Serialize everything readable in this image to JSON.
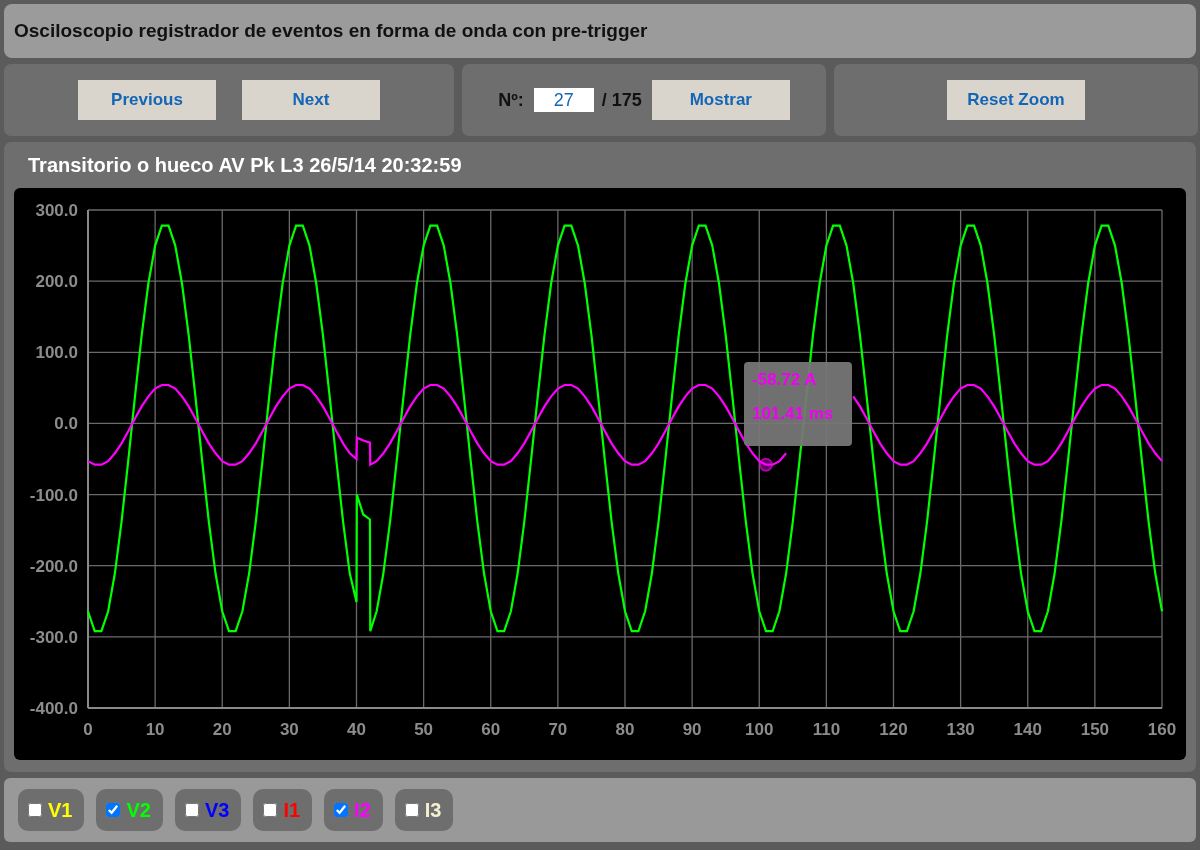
{
  "title": "Osciloscopio registrador de eventos en forma de onda con pre-trigger",
  "toolbar": {
    "previous": "Previous",
    "next": "Next",
    "number_label": "Nº:",
    "number_value": "27",
    "total": "/ 175",
    "show": "Mostrar",
    "reset_zoom": "Reset Zoom"
  },
  "chart": {
    "heading": "Transitorio o hueco AV Pk L3 26/5/14 20:32:59",
    "tooltip": {
      "lines": [
        "-58.72 A",
        "101.41 ms"
      ]
    },
    "chart_data": {
      "type": "line",
      "grid": true,
      "xlim": [
        0,
        160
      ],
      "ylim": [
        -400,
        300
      ],
      "xticks": [
        0,
        10,
        20,
        30,
        40,
        50,
        60,
        70,
        80,
        90,
        100,
        110,
        120,
        130,
        140,
        150,
        160
      ],
      "yticks": [
        {
          "value": 300,
          "label": "300.0"
        },
        {
          "value": 200,
          "label": "200.0"
        },
        {
          "value": 100,
          "label": "100.0"
        },
        {
          "value": 0,
          "label": "0.0"
        },
        {
          "value": -100,
          "label": "-100.0"
        },
        {
          "value": -200,
          "label": "-200.0"
        },
        {
          "value": -300,
          "label": "-300.0"
        },
        {
          "value": -400,
          "label": "-400.0"
        }
      ],
      "x": [
        0,
        1,
        2,
        3,
        4,
        5,
        6,
        7,
        8,
        9,
        10,
        11,
        12,
        13,
        14,
        15,
        16,
        17,
        18,
        19,
        20,
        21,
        22,
        23,
        24,
        25,
        26,
        27,
        28,
        29,
        30,
        31,
        32,
        33,
        34,
        35,
        36,
        37,
        38,
        39,
        40,
        40.05,
        41,
        42,
        42.05,
        43,
        44,
        45,
        46,
        47,
        48,
        49,
        50,
        51,
        52,
        53,
        54,
        55,
        56,
        57,
        58,
        59,
        60,
        61,
        62,
        63,
        64,
        65,
        66,
        67,
        68,
        69,
        70,
        71,
        72,
        73,
        74,
        75,
        76,
        77,
        78,
        79,
        80,
        81,
        82,
        83,
        84,
        85,
        86,
        87,
        88,
        89,
        90,
        91,
        92,
        93,
        94,
        95,
        96,
        97,
        98,
        99,
        100,
        101,
        102,
        103,
        104,
        105,
        106,
        108,
        109,
        110,
        111,
        112,
        113,
        114,
        115,
        116,
        117,
        118,
        119,
        120,
        121,
        122,
        123,
        124,
        125,
        126,
        127,
        128,
        129,
        130,
        131,
        132,
        133,
        134,
        135,
        136,
        137,
        138,
        139,
        140,
        141,
        142,
        143,
        144,
        145,
        146,
        147,
        148,
        149,
        150,
        151,
        152,
        153,
        154,
        155,
        156,
        157,
        158,
        159,
        160
      ],
      "series": [
        {
          "color": "#00ff00",
          "values": [
            -264,
            -292,
            -292,
            -264,
            -211,
            -138,
            -52,
            38,
            124,
            197,
            250,
            278,
            278,
            250,
            197,
            124,
            38,
            -52,
            -138,
            -211,
            -264,
            -292,
            -292,
            -264,
            -211,
            -138,
            -52,
            38,
            124,
            197,
            250,
            278,
            278,
            250,
            197,
            124,
            38,
            -52,
            -138,
            -211,
            -251,
            -100,
            -128,
            -135,
            -292,
            -264,
            -211,
            -138,
            -52,
            38,
            124,
            197,
            250,
            278,
            278,
            250,
            197,
            124,
            38,
            -52,
            -138,
            -211,
            -264,
            -292,
            -292,
            -264,
            -211,
            -138,
            -52,
            38,
            124,
            197,
            250,
            278,
            278,
            250,
            197,
            124,
            38,
            -52,
            -138,
            -211,
            -264,
            -292,
            -292,
            -264,
            -211,
            -138,
            -52,
            38,
            124,
            197,
            250,
            278,
            278,
            250,
            197,
            124,
            38,
            -52,
            -138,
            -211,
            -264,
            -292,
            -292,
            -264,
            -211,
            -138,
            -52,
            124,
            197,
            250,
            278,
            278,
            250,
            197,
            124,
            38,
            -52,
            -138,
            -211,
            -264,
            -292,
            -292,
            -264,
            -211,
            -138,
            -52,
            38,
            124,
            197,
            250,
            278,
            278,
            250,
            197,
            124,
            38,
            -52,
            -138,
            -211,
            -264,
            -292,
            -292,
            -264,
            -211,
            -138,
            -52,
            38,
            124,
            197,
            250,
            278,
            278,
            250,
            197,
            124,
            38,
            -52,
            -138,
            -211,
            -264
          ]
        },
        {
          "color": "#ff00ff",
          "values": [
            -53,
            -58,
            -58,
            -53,
            -42,
            -28,
            -11,
            7,
            24,
            38,
            49,
            54,
            54,
            49,
            38,
            24,
            7,
            -11,
            -28,
            -42,
            -53,
            -58,
            -58,
            -53,
            -42,
            -28,
            -11,
            7,
            24,
            38,
            49,
            54,
            54,
            49,
            38,
            24,
            7,
            -11,
            -28,
            -42,
            -50,
            -20,
            -24,
            -27,
            -58,
            -53,
            -42,
            -28,
            -11,
            7,
            24,
            38,
            49,
            54,
            54,
            49,
            38,
            24,
            7,
            -11,
            -28,
            -42,
            -53,
            -58,
            -58,
            -53,
            -42,
            -28,
            -11,
            7,
            24,
            38,
            49,
            54,
            54,
            49,
            38,
            24,
            7,
            -11,
            -28,
            -42,
            -53,
            -58,
            -58,
            -53,
            -42,
            -28,
            -11,
            7,
            24,
            38,
            49,
            54,
            54,
            49,
            38,
            24,
            7,
            -11,
            -28,
            -42,
            -53,
            -58,
            -58,
            -53,
            -42,
            null,
            null,
            null,
            null,
            null,
            null,
            null,
            null,
            38,
            24,
            7,
            -11,
            -28,
            -42,
            -53,
            -58,
            -58,
            -53,
            -42,
            -28,
            -11,
            7,
            24,
            38,
            49,
            54,
            54,
            49,
            38,
            24,
            7,
            -11,
            -28,
            -42,
            -53,
            -58,
            -58,
            -53,
            -42,
            -28,
            -11,
            7,
            24,
            38,
            49,
            54,
            54,
            49,
            38,
            24,
            7,
            -11,
            -28,
            -42,
            -53
          ]
        }
      ]
    }
  },
  "channels": [
    {
      "label": "V1",
      "color": "#ffff00",
      "checked": false
    },
    {
      "label": "V2",
      "color": "#00ff00",
      "checked": true
    },
    {
      "label": "V3",
      "color": "#0000ff",
      "checked": false
    },
    {
      "label": "I1",
      "color": "#ff0000",
      "checked": false
    },
    {
      "label": "I2",
      "color": "#ff00ff",
      "checked": true
    },
    {
      "label": "I3",
      "color": "#f5f0d0",
      "checked": false
    }
  ]
}
